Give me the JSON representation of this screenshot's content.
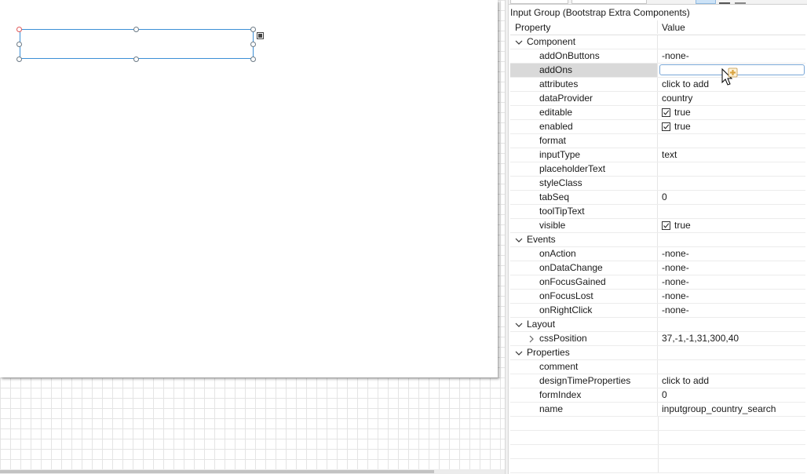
{
  "panel": {
    "title": "Input Group (Bootstrap Extra Components)",
    "col_property": "Property",
    "col_value": "Value"
  },
  "categories": {
    "component": "Component",
    "events": "Events",
    "layout": "Layout",
    "properties": "Properties"
  },
  "component": {
    "addOnButtons": {
      "label": "addOnButtons",
      "value": "-none-"
    },
    "addOns": {
      "label": "addOns",
      "value": ""
    },
    "attributes": {
      "label": "attributes",
      "value": "click to add"
    },
    "dataProvider": {
      "label": "dataProvider",
      "value": "country"
    },
    "editable": {
      "label": "editable",
      "value": "true"
    },
    "enabled": {
      "label": "enabled",
      "value": "true"
    },
    "format": {
      "label": "format",
      "value": ""
    },
    "inputType": {
      "label": "inputType",
      "value": "text"
    },
    "placeholderText": {
      "label": "placeholderText",
      "value": ""
    },
    "styleClass": {
      "label": "styleClass",
      "value": ""
    },
    "tabSeq": {
      "label": "tabSeq",
      "value": "0"
    },
    "toolTipText": {
      "label": "toolTipText",
      "value": ""
    },
    "visible": {
      "label": "visible",
      "value": "true"
    }
  },
  "events": {
    "onAction": {
      "label": "onAction",
      "value": "-none-"
    },
    "onDataChange": {
      "label": "onDataChange",
      "value": "-none-"
    },
    "onFocusGained": {
      "label": "onFocusGained",
      "value": "-none-"
    },
    "onFocusLost": {
      "label": "onFocusLost",
      "value": "-none-"
    },
    "onRightClick": {
      "label": "onRightClick",
      "value": "-none-"
    }
  },
  "layout": {
    "cssPosition": {
      "label": "cssPosition",
      "value": "37,-1,-1,31,300,40"
    }
  },
  "properties": {
    "comment": {
      "label": "comment",
      "value": ""
    },
    "designTimeProperties": {
      "label": "designTimeProperties",
      "value": "click to add"
    },
    "formIndex": {
      "label": "formIndex",
      "value": "0"
    },
    "name": {
      "label": "name",
      "value": "inputgroup_country_search"
    }
  },
  "colors": {
    "selection": "#3c8fd6",
    "selected_row": "#d9d9d9",
    "cursor_plus": "#d9a441"
  }
}
